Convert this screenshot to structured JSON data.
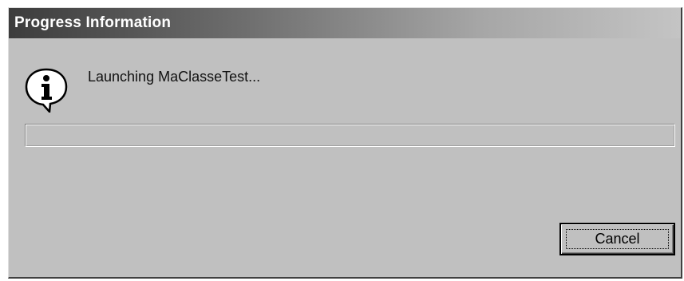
{
  "dialog": {
    "title": "Progress Information",
    "icon": "info-icon",
    "message": "Launching MaClasseTest...",
    "progress": 0,
    "cancel_label": "Cancel"
  }
}
